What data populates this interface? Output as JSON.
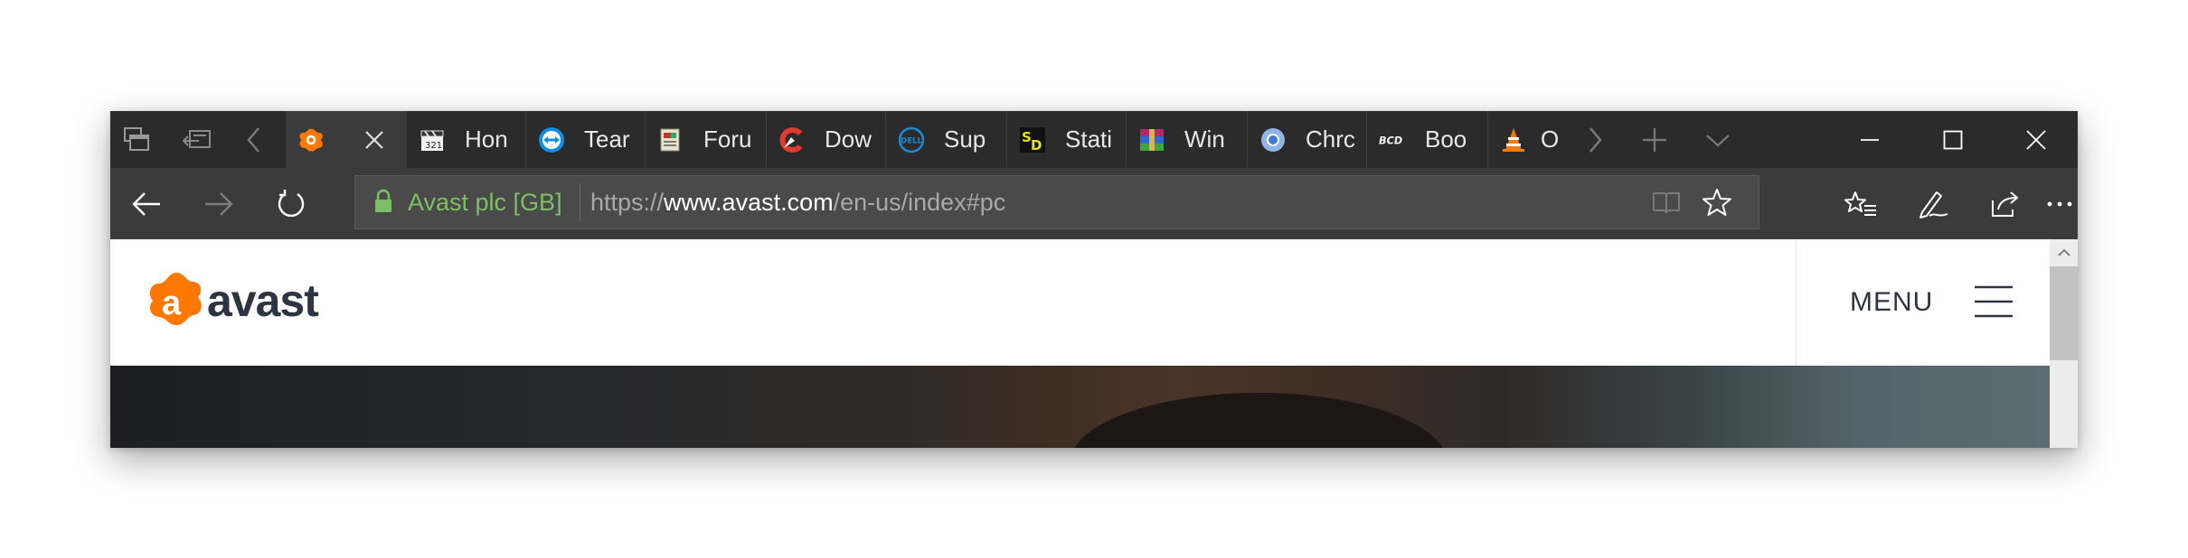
{
  "browser": {
    "tab_strip": {
      "set_aside_label": "",
      "tabs": [
        {
          "title": "",
          "favicon": "avast-icon",
          "active": true
        },
        {
          "title": "Hon",
          "favicon": "clapperboard-icon"
        },
        {
          "title": "Tear",
          "favicon": "teamviewer-icon"
        },
        {
          "title": "Foru",
          "favicon": "forum-icon"
        },
        {
          "title": "Dow",
          "favicon": "ccleaner-icon"
        },
        {
          "title": "Sup",
          "favicon": "dell-icon"
        },
        {
          "title": "Stati",
          "favicon": "sd-icon"
        },
        {
          "title": "Win",
          "favicon": "winrar-icon"
        },
        {
          "title": "Chrc",
          "favicon": "chromium-icon"
        },
        {
          "title": "Boo",
          "favicon": "bcd-icon"
        },
        {
          "title": "O",
          "favicon": "vlc-icon"
        }
      ]
    },
    "address_bar": {
      "site_identity": "Avast plc [GB]",
      "url_scheme": "https://",
      "url_host": "www.avast.com",
      "url_path": "/en-us/index#pc"
    }
  },
  "page": {
    "logo_text": "avast",
    "menu_label": "MENU"
  },
  "colors": {
    "chrome_dark": "#2b2b2b",
    "chrome_nav": "#3b3b3b",
    "secure_green": "#7dbf65",
    "avast_orange": "#ff7800",
    "avast_navy": "#2f3443"
  }
}
